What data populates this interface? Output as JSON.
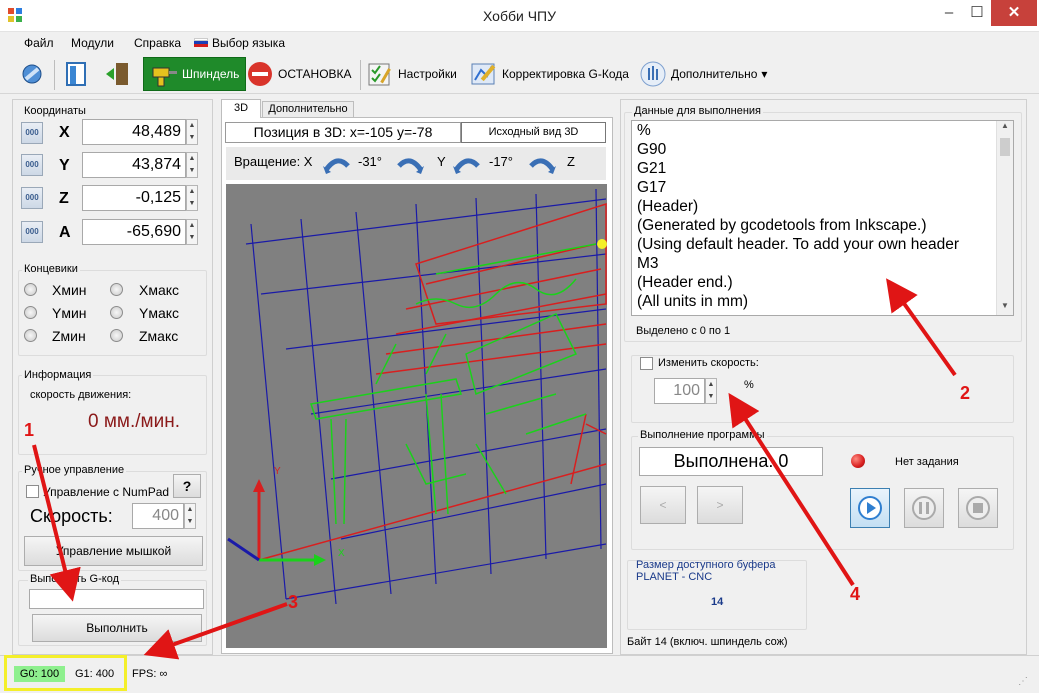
{
  "window": {
    "title": "Хобби ЧПУ",
    "minimize": "–",
    "maximize": "☐",
    "close": "✕"
  },
  "menu": {
    "items": [
      "Файл",
      "Модули",
      "Справка",
      "Выбор языка"
    ]
  },
  "toolbar": {
    "spindle": "Шпиндель",
    "stop": "ОСТАНОВКА",
    "settings": "Настройки",
    "gcode_correct": "Корректировка G-Кода",
    "extra": "Дополнительно",
    "extra_caret": "▾"
  },
  "coords": {
    "label": "Координаты",
    "btn_glyph": "000",
    "x_label": "X",
    "x_value": "48,489",
    "y_label": "Y",
    "y_value": "43,874",
    "z_label": "Z",
    "z_value": "-0,125",
    "a_label": "A",
    "a_value": "-65,690",
    "spin_up": "▲",
    "spin_down": "▼"
  },
  "limits": {
    "label": "Концевики",
    "xmin": "Xмин",
    "xmax": "Xмакс",
    "ymin": "Yмин",
    "ymax": "Yмакс",
    "zmin": "Zмин",
    "zmax": "Zмакс"
  },
  "info": {
    "label": "Информация",
    "speed_caption": "скорость движения:",
    "speed_value": "0 мм./мин."
  },
  "manual": {
    "label": "Ручное управление",
    "numpad": "Управление с NumPad",
    "help": "?",
    "speed_label": "Скорость:",
    "speed_value": "400",
    "mouse_btn": "Управление мышкой"
  },
  "exec_gcode": {
    "label": "Выполнить G-код",
    "input_value": "",
    "button": "Выполнить"
  },
  "tabs": {
    "t3d": "3D",
    "extra": "Дополнительно"
  },
  "view": {
    "position": "Позиция в 3D: x=-105 y=-78",
    "reset_btn": "Исходный вид 3D",
    "rotation_label": "Вращение: X",
    "rot_x": "-31°",
    "y_label": "Y",
    "rot_y": "-17°",
    "z_label": "Z",
    "axis_x": "X",
    "axis_y": "Y"
  },
  "data_panel": {
    "label": "Данные для выполнения",
    "lines": [
      "%",
      "G90",
      "G21",
      "G17",
      "(Header)",
      "(Generated by gcodetools from Inkscape.)",
      "(Using default header. To add your own header",
      "M3",
      "(Header end.)",
      "(All units in mm)"
    ],
    "selection": "Выделено с 0 по 1",
    "change_speed": "Изменить скорость:",
    "speed_value": "100",
    "percent": "%",
    "scroll_up": "▲",
    "scroll_down": "▼"
  },
  "program": {
    "label": "Выполнение программы",
    "status": "Выполнена: 0",
    "task": "Нет задания",
    "prev": "<",
    "next": ">"
  },
  "buffer": {
    "label": "Размер доступного буфера",
    "device": "PLANET - CNC",
    "value": "14",
    "bytes": "Байт 14 (включ. шпиндель сож)"
  },
  "status": {
    "g0": "G0: 100",
    "g1": "G1: 400",
    "fps": "FPS: ∞"
  },
  "annotations": {
    "n1": "1",
    "n2": "2",
    "n3": "3",
    "n4": "4"
  },
  "colors": {
    "accent_green": "#1f8a2a",
    "arrow_red": "#e01515",
    "highlight_yellow": "#f4ef2a",
    "led_red": "#d81f1f"
  }
}
